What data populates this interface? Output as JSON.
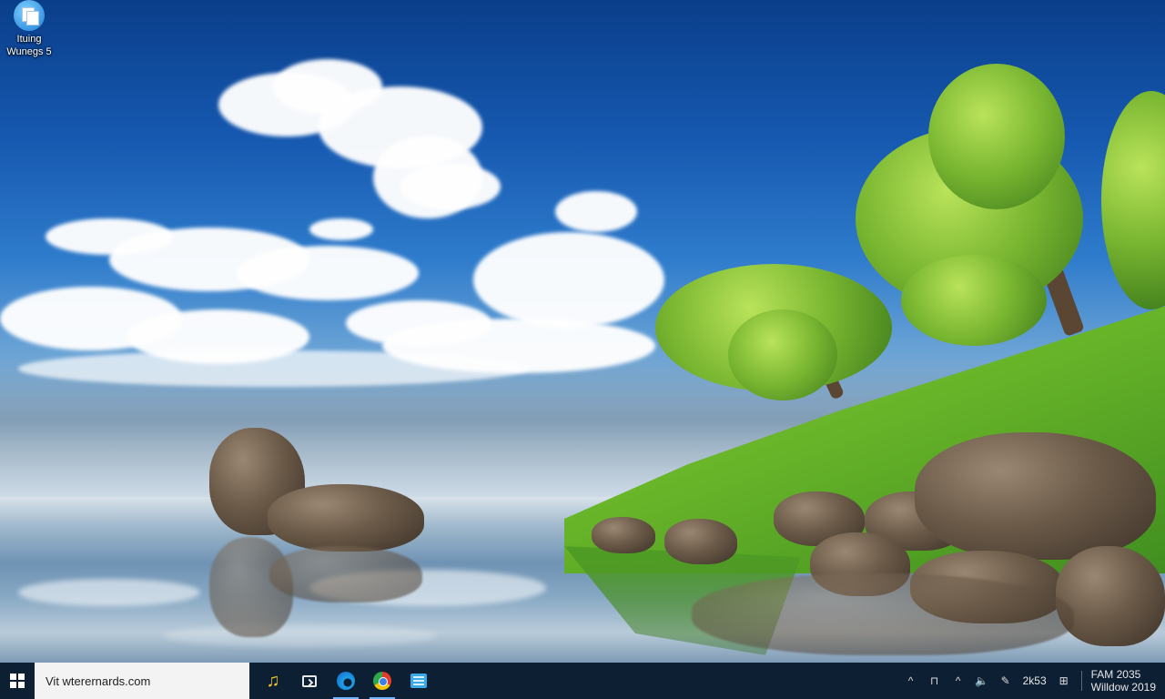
{
  "desktop": {
    "icons": [
      {
        "label_line1": "Ituing",
        "label_line2": "Wunegs 5"
      }
    ]
  },
  "taskbar": {
    "search": {
      "value": "Vit wterernards.com",
      "placeholder": ""
    },
    "apps": [
      {
        "icon": "music-note-icon",
        "glyph": "♫"
      },
      {
        "icon": "terminal-icon"
      },
      {
        "icon": "edge-icon"
      },
      {
        "icon": "chrome-icon"
      },
      {
        "icon": "file-explorer-icon"
      }
    ],
    "tray": {
      "chevron": "^",
      "network_glyph": "⊓",
      "caret_glyph": "^",
      "volume_glyph": "🔈",
      "pen_glyph": "✎",
      "time_text": "2k53",
      "keyboard_glyph": "⊞",
      "clock_line1": "FAM 2035",
      "clock_line2": "Willdow 2019"
    }
  },
  "colors": {
    "taskbar_bg": "#0d1f33",
    "search_bg": "#f3f3f3",
    "accent": "#6fb4ff"
  }
}
